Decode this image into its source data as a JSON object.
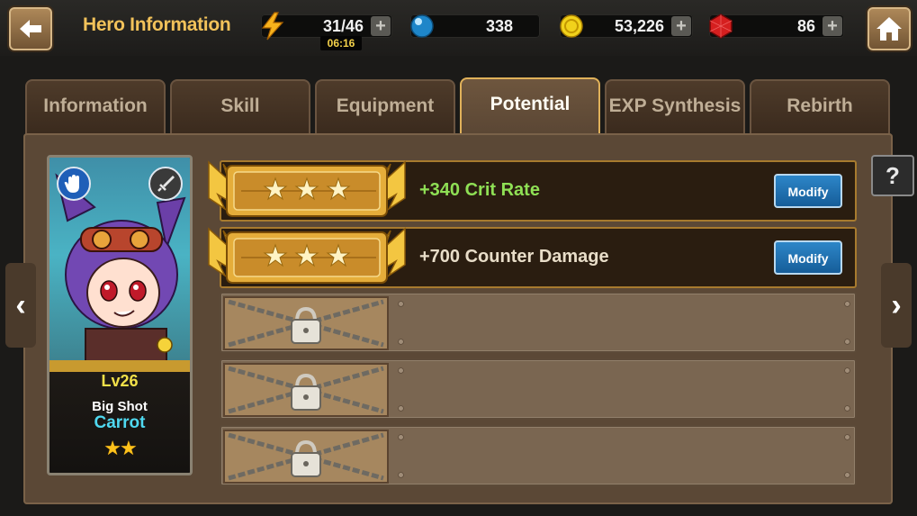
{
  "header": {
    "title": "Hero Information",
    "back_icon": "arrow-left-icon",
    "home_icon": "house-icon"
  },
  "resources": {
    "stamina": {
      "value": "31/46",
      "timer": "06:16",
      "icon": "lightning-icon"
    },
    "crystal": {
      "value": "338",
      "icon": "blue-orb-icon"
    },
    "gold": {
      "value": "53,226",
      "icon": "gold-coin-icon"
    },
    "ruby": {
      "value": "86",
      "icon": "red-gem-icon"
    },
    "plus_label": "+"
  },
  "tabs": [
    {
      "label": "Information",
      "active": false
    },
    {
      "label": "Skill",
      "active": false
    },
    {
      "label": "Equipment",
      "active": false
    },
    {
      "label": "Potential",
      "active": true
    },
    {
      "label": "EXP Synthesis",
      "active": false
    },
    {
      "label": "Rebirth",
      "active": false
    }
  ],
  "hero": {
    "level": "Lv26",
    "class": "Big Shot",
    "name": "Carrot",
    "stars": 2,
    "stars_text": "★★"
  },
  "potentials": [
    {
      "text": "+340 Crit Rate",
      "stars": 3,
      "color": "#8fe055",
      "button": "Modify",
      "locked": false
    },
    {
      "text": "+700 Counter Damage",
      "stars": 3,
      "color": "#e8ddc8",
      "button": "Modify",
      "locked": false
    },
    {
      "locked": true
    },
    {
      "locked": true
    },
    {
      "locked": true
    }
  ],
  "nav": {
    "left": "‹",
    "right": "›",
    "help": "?"
  },
  "colors": {
    "accent_gold": "#f2c25a",
    "modify_blue": "#2d86c8",
    "crit_green": "#8fe055"
  }
}
